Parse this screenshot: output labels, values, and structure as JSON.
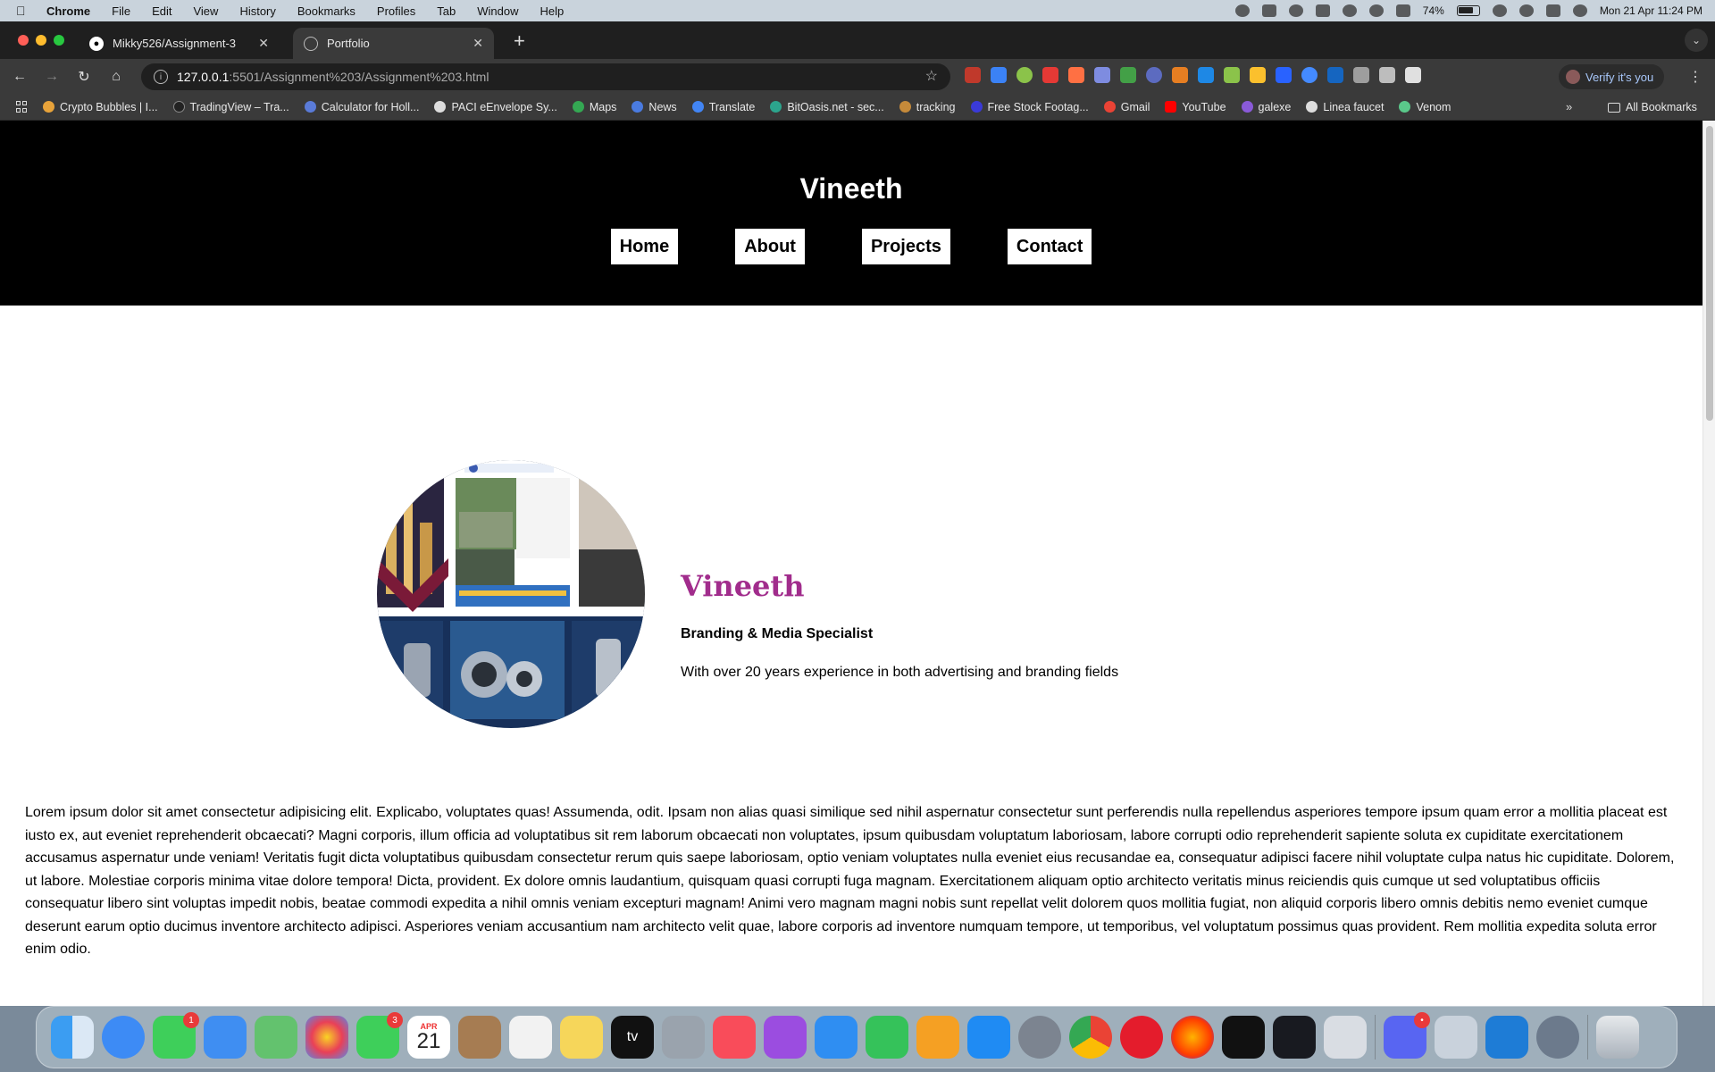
{
  "menubar": {
    "app": "Chrome",
    "items": [
      "File",
      "Edit",
      "View",
      "History",
      "Bookmarks",
      "Profiles",
      "Tab",
      "Window",
      "Help"
    ],
    "battery": "74%",
    "clock": "Mon 21 Apr  11:24 PM"
  },
  "tabs": [
    {
      "title": "Mikky526/Assignment-3",
      "icon": "github-icon"
    },
    {
      "title": "Portfolio",
      "icon": "globe-icon"
    }
  ],
  "address": {
    "host": "127.0.0.1",
    "path": ":5501/Assignment%203/Assignment%203.html"
  },
  "profile_button": "Verify it's you",
  "bookmarks": [
    {
      "label": "Crypto Bubbles | I...",
      "color": "#e8a33a"
    },
    {
      "label": "TradingView – Tra...",
      "color": "#222222"
    },
    {
      "label": "Calculator for Holl...",
      "color": "#5a7bd8"
    },
    {
      "label": "PACI eEnvelope Sy...",
      "color": "#dddddd"
    },
    {
      "label": "Maps",
      "color": "#34a853"
    },
    {
      "label": "News",
      "color": "#4a7be0"
    },
    {
      "label": "Translate",
      "color": "#4285f4"
    },
    {
      "label": "BitOasis.net - sec...",
      "color": "#2ca58d"
    },
    {
      "label": "tracking",
      "color": "#c58a3a"
    },
    {
      "label": "Free Stock Footag...",
      "color": "#3a3ad8"
    },
    {
      "label": "Gmail",
      "color": "#ea4335"
    },
    {
      "label": "YouTube",
      "color": "#ff0000"
    },
    {
      "label": "galexe",
      "color": "#8a5ad8"
    },
    {
      "label": "Linea faucet",
      "color": "#dddddd"
    },
    {
      "label": "Venom",
      "color": "#5ac88a"
    }
  ],
  "all_bookmarks": "All Bookmarks",
  "site": {
    "title": "Vineeth",
    "nav": [
      "Home",
      "About",
      "Projects",
      "Contact"
    ],
    "hero": {
      "name": "Vineeth",
      "role": "Branding & Media Specialist",
      "desc": "With over 20 years experience in both advertising and branding fields"
    },
    "lorem": "Lorem ipsum dolor sit amet consectetur adipisicing elit. Explicabo, voluptates quas! Assumenda, odit. Ipsam non alias quasi similique sed nihil aspernatur consectetur sunt perferendis nulla repellendus asperiores tempore ipsum quam error a mollitia placeat est iusto ex, aut eveniet reprehenderit obcaecati? Magni corporis, illum officia ad voluptatibus sit rem laborum obcaecati non voluptates, ipsum quibusdam voluptatum laboriosam, labore corrupti odio reprehenderit sapiente soluta ex cupiditate exercitationem accusamus aspernatur unde veniam! Veritatis fugit dicta voluptatibus quibusdam consectetur rerum quis saepe laboriosam, optio veniam voluptates nulla eveniet eius recusandae ea, consequatur adipisci facere nihil voluptate culpa natus hic cupiditate. Dolorem, ut labore. Molestiae corporis minima vitae dolore tempora! Dicta, provident. Ex dolore omnis laudantium, quisquam quasi corrupti fuga magnam. Exercitationem aliquam optio architecto veritatis minus reiciendis quis cumque ut sed voluptatibus officiis consequatur libero sint voluptas impedit nobis, beatae commodi expedita a nihil omnis veniam excepturi magnam! Animi vero magnam magni nobis sunt repellat velit dolorem quos mollitia fugiat, non aliquid corporis libero omnis debitis nemo eveniet cumque deserunt earum optio ducimus inventore architecto adipisci. Asperiores veniam accusantium nam architecto velit quae, labore corporis ad inventore numquam tempore, ut temporibus, vel voluptatum possimus quas provident. Rem mollitia expedita soluta error enim odio."
  },
  "dock": {
    "calendar_month": "APR",
    "calendar_day": "21",
    "messages_badge": "1",
    "facetime_badge": "3",
    "tv_label": "tv",
    "discord_badge": "•"
  }
}
